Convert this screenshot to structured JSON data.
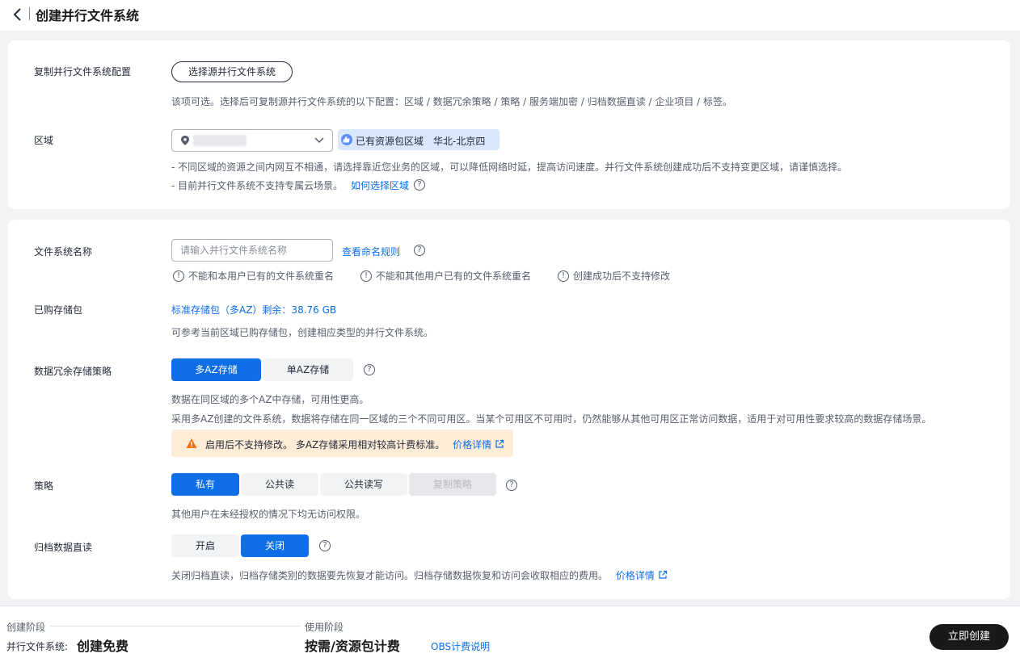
{
  "header": {
    "title": "创建并行文件系统"
  },
  "copy_config": {
    "label": "复制并行文件系统配置",
    "button": "选择源并行文件系统",
    "help": "该项可选。选择后可复制源并行文件系统的以下配置：区域 / 数据冗余策略 / 策略 / 服务端加密 / 归档数据直读 / 企业项目 / 标签。"
  },
  "region": {
    "label": "区域",
    "badge_text": "已有资源包区域",
    "badge_region": "华北-北京四",
    "help1": "- 不同区域的资源之间内网互不相通，请选择靠近您业务的区域，可以降低网络时延，提高访问速度。并行文件系统创建成功后不支持变更区域，请谨慎选择。",
    "help2": "- 目前并行文件系统不支持专属云场景。",
    "help2_link": "如何选择区域"
  },
  "name": {
    "label": "文件系统名称",
    "placeholder": "请输入并行文件系统名称",
    "rules_link": "查看命名规则",
    "rule1": "不能和本用户已有的文件系统重名",
    "rule2": "不能和其他用户已有的文件系统重名",
    "rule3": "创建成功后不支持修改"
  },
  "package": {
    "label": "已购存储包",
    "value": "标准存储包（多AZ）剩余：38.76 GB",
    "help": "可参考当前区域已购存储包，创建相应类型的并行文件系统。"
  },
  "redundancy": {
    "label": "数据冗余存储策略",
    "options": [
      "多AZ存储",
      "单AZ存储"
    ],
    "help1": "数据在同区域的多个AZ中存储，可用性更高。",
    "help2": "采用多AZ创建的文件系统，数据将存储在同一区域的三个不同可用区。当某个可用区不可用时，仍然能够从其他可用区正常访问数据，适用于对可用性要求较高的数据存储场景。",
    "warning": "启用后不支持修改。 多AZ存储采用相对较高计费标准。",
    "warning_link": "价格详情"
  },
  "policy": {
    "label": "策略",
    "options": [
      "私有",
      "公共读",
      "公共读写",
      "复制策略"
    ],
    "help": "其他用户在未经授权的情况下均无访问权限。"
  },
  "archive": {
    "label": "归档数据直读",
    "options": [
      "开启",
      "关闭"
    ],
    "help": "关闭归档直读，归档存储类别的数据要先恢复才能访问。归档存储数据恢复和访问会收取相应的费用。",
    "help_link": "价格详情"
  },
  "footer": {
    "stage1_label": "创建阶段",
    "stage1_key": "并行文件系统:",
    "stage1_value": "创建免费",
    "stage2_label": "使用阶段",
    "stage2_value": "按需/资源包计费",
    "obs_link": "OBS计费说明",
    "create_button": "立即创建"
  },
  "colors": {
    "primary": "#0d6ee6",
    "badge_bg": "#d9e8fc",
    "warning_bg": "#fdecd6",
    "warning_icon": "#f66f0f"
  }
}
